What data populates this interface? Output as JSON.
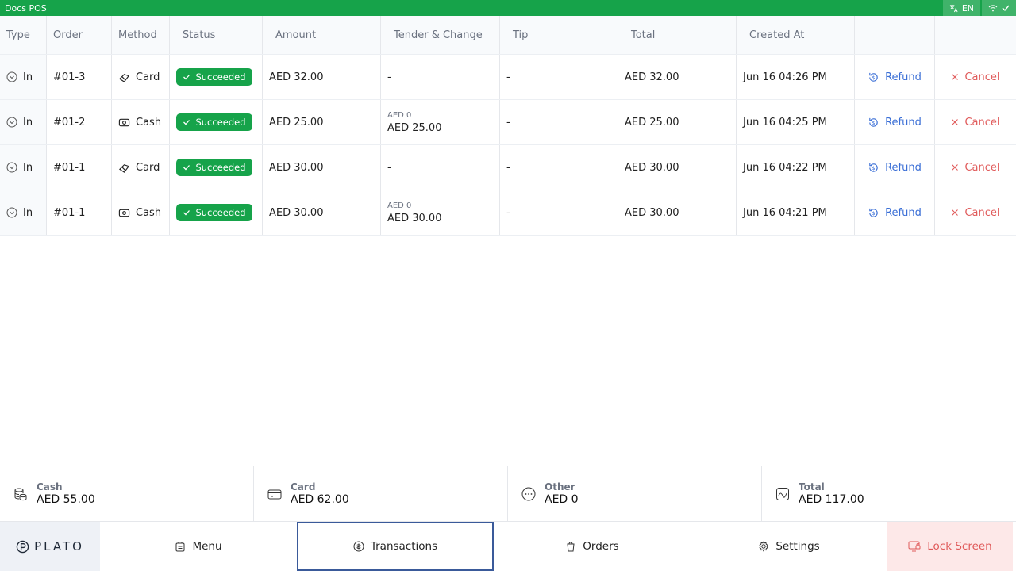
{
  "window": {
    "title": "Docs POS",
    "language": "EN"
  },
  "colors": {
    "accent": "#16a34a",
    "refund": "#3b6fd6",
    "cancel": "#e05a5a",
    "nav_active": "#3a5a9a"
  },
  "table": {
    "headers": [
      "Type",
      "Order",
      "Method",
      "Status",
      "Amount",
      "Tender & Change",
      "Tip",
      "Total",
      "Created At"
    ],
    "rows": [
      {
        "type": "In",
        "order": "#01-3",
        "method": "Card",
        "method_icon": "card-icon",
        "status": "Succeeded",
        "amount": "AED 32.00",
        "tender_small": "",
        "tender": "-",
        "tip": "-",
        "total": "AED 32.00",
        "created": "Jun 16 04:26 PM",
        "refund": "Refund",
        "cancel": "Cancel"
      },
      {
        "type": "In",
        "order": "#01-2",
        "method": "Cash",
        "method_icon": "cash-icon",
        "status": "Succeeded",
        "amount": "AED 25.00",
        "tender_small": "AED 0",
        "tender": "AED 25.00",
        "tip": "-",
        "total": "AED 25.00",
        "created": "Jun 16 04:25 PM",
        "refund": "Refund",
        "cancel": "Cancel"
      },
      {
        "type": "In",
        "order": "#01-1",
        "method": "Card",
        "method_icon": "card-icon",
        "status": "Succeeded",
        "amount": "AED 30.00",
        "tender_small": "",
        "tender": "-",
        "tip": "-",
        "total": "AED 30.00",
        "created": "Jun 16 04:22 PM",
        "refund": "Refund",
        "cancel": "Cancel"
      },
      {
        "type": "In",
        "order": "#01-1",
        "method": "Cash",
        "method_icon": "cash-icon",
        "status": "Succeeded",
        "amount": "AED 30.00",
        "tender_small": "AED 0",
        "tender": "AED 30.00",
        "tip": "-",
        "total": "AED 30.00",
        "created": "Jun 16 04:21 PM",
        "refund": "Refund",
        "cancel": "Cancel"
      }
    ]
  },
  "summary": [
    {
      "label": "Cash",
      "value": "AED 55.00",
      "icon": "coins-icon"
    },
    {
      "label": "Card",
      "value": "AED 62.00",
      "icon": "credit-card-icon"
    },
    {
      "label": "Other",
      "value": "AED 0",
      "icon": "more-icon"
    },
    {
      "label": "Total",
      "value": "AED 117.00",
      "icon": "chart-icon"
    }
  ],
  "nav": {
    "logo": "PLATO",
    "items": [
      {
        "label": "Menu",
        "icon": "menu-icon"
      },
      {
        "label": "Transactions",
        "icon": "transactions-icon",
        "active": true
      },
      {
        "label": "Orders",
        "icon": "orders-icon"
      },
      {
        "label": "Settings",
        "icon": "settings-icon"
      }
    ],
    "lock": "Lock Screen"
  }
}
